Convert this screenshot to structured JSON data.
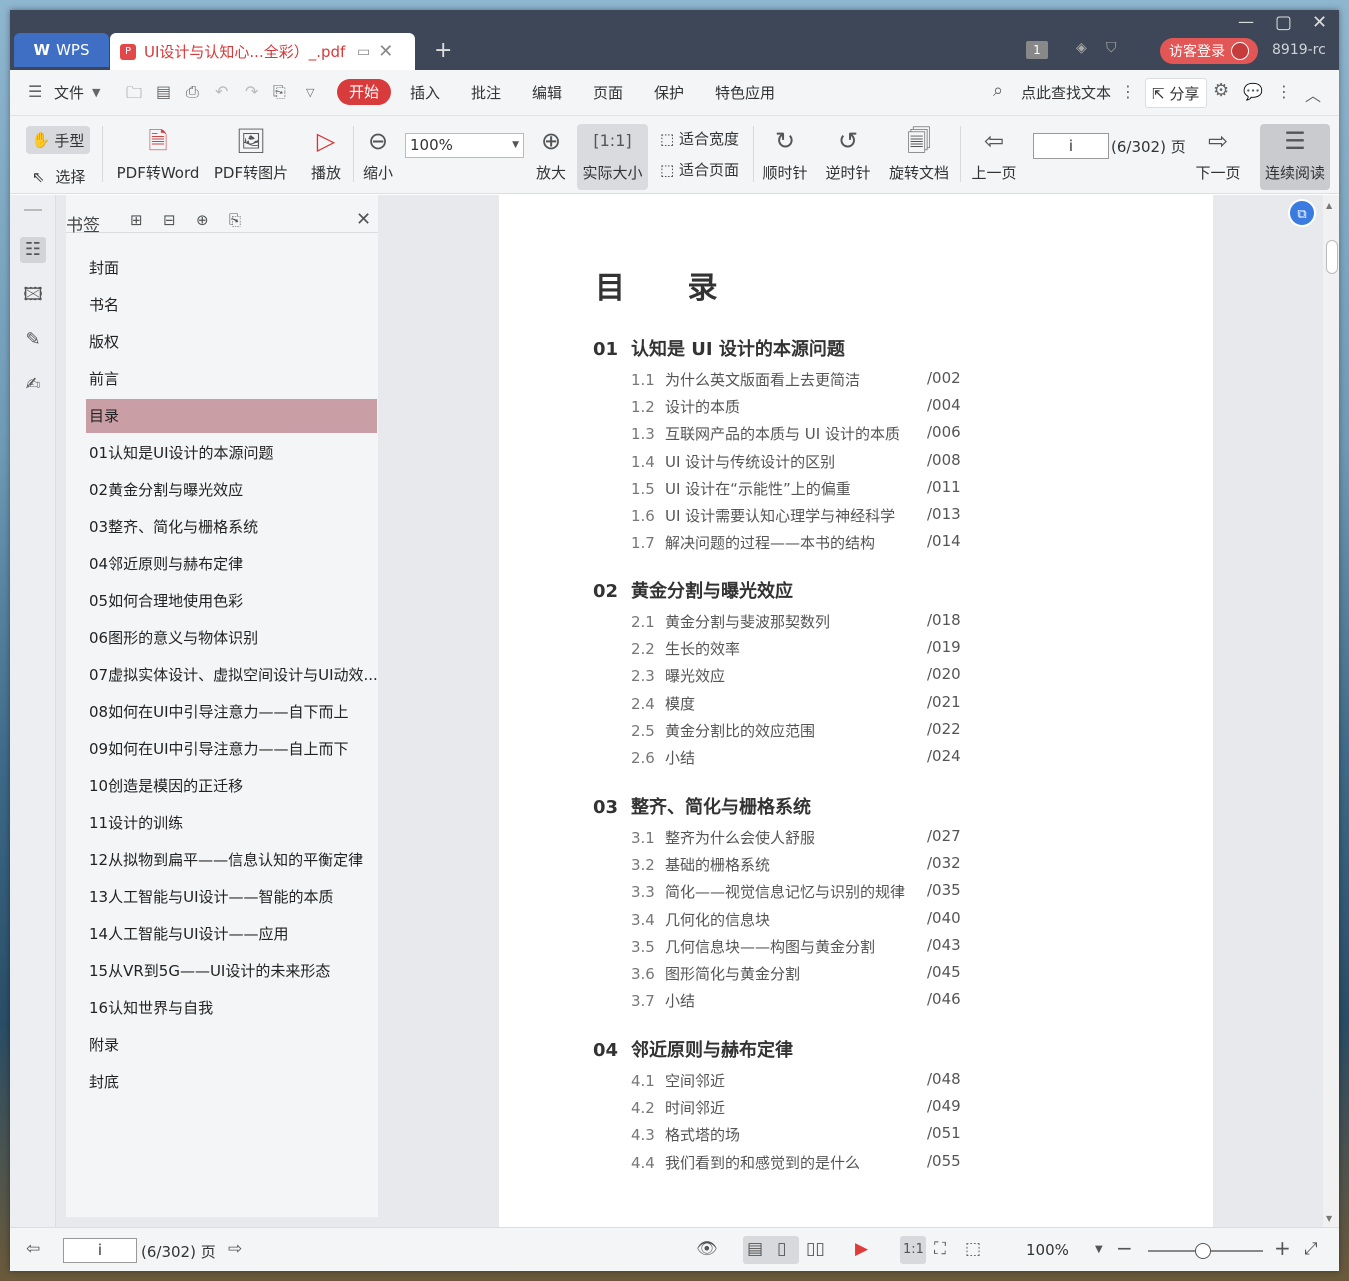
{
  "titlebar": {
    "wps_label": "WPS",
    "doc_tab_title": "UI设计与认知心...全彩）_.pdf",
    "page_count_badge": "1",
    "login_label": "访客登录",
    "user_id": "8919-rc"
  },
  "menubar": {
    "file": "文件",
    "tabs": [
      "开始",
      "插入",
      "批注",
      "编辑",
      "页面",
      "保护",
      "特色应用"
    ],
    "search": "点此查找文本",
    "share": "分享"
  },
  "toolbar": {
    "hand": "手型",
    "select": "选择",
    "pdf_to_word": "PDF转Word",
    "pdf_to_image": "PDF转图片",
    "play": "播放",
    "zoom_out": "缩小",
    "zoom_value": "100%",
    "zoom_in": "放大",
    "actual_size": "实际大小",
    "fit_width": "适合宽度",
    "fit_page": "适合页面",
    "clockwise": "顺时针",
    "counter_clockwise": "逆时针",
    "rotate_doc": "旋转文档",
    "prev_page": "上一页",
    "page_input": "i",
    "page_total": "(6/302) 页",
    "next_page": "下一页",
    "continuous": "连续阅读"
  },
  "bookmarks": {
    "title": "书签",
    "items": [
      {
        "label": "封面",
        "expandable": false
      },
      {
        "label": "书名",
        "expandable": false
      },
      {
        "label": "版权",
        "expandable": false
      },
      {
        "label": "前言",
        "expandable": false
      },
      {
        "label": "目录",
        "expandable": false,
        "selected": true
      },
      {
        "label": "01认知是UI设计的本源问题",
        "expandable": true
      },
      {
        "label": "02黄金分割与曝光效应",
        "expandable": true
      },
      {
        "label": "03整齐、简化与栅格系统",
        "expandable": true
      },
      {
        "label": "04邻近原则与赫布定律",
        "expandable": true
      },
      {
        "label": "05如何合理地使用色彩",
        "expandable": true
      },
      {
        "label": "06图形的意义与物体识别",
        "expandable": true
      },
      {
        "label": "07虚拟实体设计、虚拟空间设计与UI动效...",
        "expandable": true
      },
      {
        "label": "08如何在UI中引导注意力——自下而上",
        "expandable": true
      },
      {
        "label": "09如何在UI中引导注意力——自上而下",
        "expandable": true
      },
      {
        "label": "10创造是模因的正迁移",
        "expandable": true
      },
      {
        "label": "11设计的训练",
        "expandable": true
      },
      {
        "label": "12从拟物到扁平——信息认知的平衡定律",
        "expandable": true
      },
      {
        "label": "13人工智能与UI设计——智能的本质",
        "expandable": true
      },
      {
        "label": "14人工智能与UI设计——应用",
        "expandable": true
      },
      {
        "label": "15从VR到5G——UI设计的未来形态",
        "expandable": true
      },
      {
        "label": "16认知世界与自我",
        "expandable": true
      },
      {
        "label": "附录",
        "expandable": false
      },
      {
        "label": "封底",
        "expandable": false
      }
    ]
  },
  "document": {
    "toc_title": "目 录",
    "chapters": [
      {
        "num": "01",
        "title": "认知是 UI 设计的本源问题",
        "entries": [
          {
            "num": "1.1",
            "text": "为什么英文版面看上去更简洁",
            "page": "/002"
          },
          {
            "num": "1.2",
            "text": "设计的本质",
            "page": "/004"
          },
          {
            "num": "1.3",
            "text": "互联网产品的本质与 UI 设计的本质",
            "page": "/006"
          },
          {
            "num": "1.4",
            "text": "UI 设计与传统设计的区别",
            "page": "/008"
          },
          {
            "num": "1.5",
            "text": "UI 设计在“示能性”上的偏重",
            "page": "/011"
          },
          {
            "num": "1.6",
            "text": "UI 设计需要认知心理学与神经科学",
            "page": "/013"
          },
          {
            "num": "1.7",
            "text": "解决问题的过程——本书的结构",
            "page": "/014"
          }
        ]
      },
      {
        "num": "02",
        "title": "黄金分割与曝光效应",
        "entries": [
          {
            "num": "2.1",
            "text": "黄金分割与斐波那契数列",
            "page": "/018"
          },
          {
            "num": "2.2",
            "text": "生长的效率",
            "page": "/019"
          },
          {
            "num": "2.3",
            "text": "曝光效应",
            "page": "/020"
          },
          {
            "num": "2.4",
            "text": "模度",
            "page": "/021"
          },
          {
            "num": "2.5",
            "text": "黄金分割比的效应范围",
            "page": "/022"
          },
          {
            "num": "2.6",
            "text": "小结",
            "page": "/024"
          }
        ]
      },
      {
        "num": "03",
        "title": "整齐、简化与栅格系统",
        "entries": [
          {
            "num": "3.1",
            "text": "整齐为什么会使人舒服",
            "page": "/027"
          },
          {
            "num": "3.2",
            "text": "基础的栅格系统",
            "page": "/032"
          },
          {
            "num": "3.3",
            "text": "简化——视觉信息记忆与识别的规律",
            "page": "/035"
          },
          {
            "num": "3.4",
            "text": "几何化的信息块",
            "page": "/040"
          },
          {
            "num": "3.5",
            "text": "几何信息块——构图与黄金分割",
            "page": "/043"
          },
          {
            "num": "3.6",
            "text": "图形简化与黄金分割",
            "page": "/045"
          },
          {
            "num": "3.7",
            "text": "小结",
            "page": "/046"
          }
        ]
      },
      {
        "num": "04",
        "title": "邻近原则与赫布定律",
        "entries": [
          {
            "num": "4.1",
            "text": "空间邻近",
            "page": "/048"
          },
          {
            "num": "4.2",
            "text": "时间邻近",
            "page": "/049"
          },
          {
            "num": "4.3",
            "text": "格式塔的场",
            "page": "/051"
          },
          {
            "num": "4.4",
            "text": "我们看到的和感觉到的是什么",
            "page": "/055"
          }
        ]
      }
    ]
  },
  "statusbar": {
    "page_input": "i",
    "page_total": "(6/302) 页",
    "zoom": "100%"
  }
}
